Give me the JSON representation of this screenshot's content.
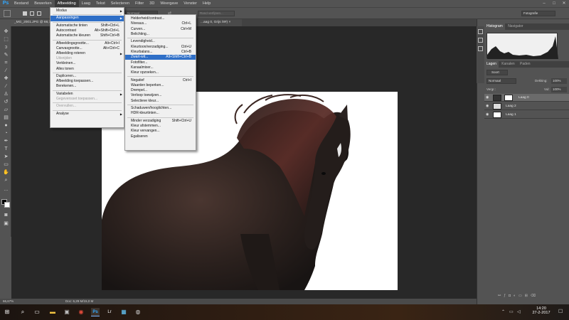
{
  "app": {
    "logo": "Ps"
  },
  "menubar": {
    "items": [
      "Bestand",
      "Bewerken",
      "Afbeelding",
      "Laag",
      "Tekst",
      "Selecteren",
      "Filter",
      "3D",
      "Weergave",
      "Venster",
      "Help"
    ],
    "active": "Afbeelding"
  },
  "window_controls": {
    "minimize": "–",
    "maximize": "□",
    "close": "✕"
  },
  "optionsbar": {
    "mode_value": "Normaal",
    "blend_field_value": "Rand verfijnen...",
    "workspace_value": "Fotografie"
  },
  "tabs": [
    {
      "label": "_MG_2001.JPG @ 66,7..."
    },
    {
      "label": "...aag 0, Grijs /8#) ×"
    }
  ],
  "menu_afbeelding": {
    "items": [
      {
        "label": "Modus",
        "shortcut": "",
        "submenu": true
      },
      {
        "sep": true
      },
      {
        "label": "Aanpassingen",
        "shortcut": "",
        "submenu": true,
        "highlight": true
      },
      {
        "sep": true
      },
      {
        "label": "Automatische tinten",
        "shortcut": "Shift+Ctrl+L"
      },
      {
        "label": "Autocontrast",
        "shortcut": "Alt+Shift+Ctrl+L"
      },
      {
        "label": "Automatische kleuren",
        "shortcut": "Shift+Ctrl+B"
      },
      {
        "sep": true
      },
      {
        "label": "Afbeeldingsgrootte...",
        "shortcut": "Alt+Ctrl+I"
      },
      {
        "label": "Canvasgrootte...",
        "shortcut": "Alt+Ctrl+C"
      },
      {
        "label": "Afbeelding roteren",
        "shortcut": "",
        "submenu": true
      },
      {
        "label": "Uitsnijden",
        "shortcut": "",
        "disabled": true
      },
      {
        "label": "Verkleinen...",
        "shortcut": ""
      },
      {
        "label": "Alles tonen",
        "shortcut": ""
      },
      {
        "sep": true
      },
      {
        "label": "Dupliceren...",
        "shortcut": ""
      },
      {
        "label": "Afbeelding toepassen...",
        "shortcut": ""
      },
      {
        "label": "Berekenen...",
        "shortcut": ""
      },
      {
        "sep": true
      },
      {
        "label": "Variabelen",
        "shortcut": "",
        "submenu": true
      },
      {
        "label": "Gegevensset toepassen...",
        "shortcut": "",
        "disabled": true
      },
      {
        "sep": true
      },
      {
        "label": "Overvullen...",
        "shortcut": "",
        "disabled": true
      },
      {
        "sep": true
      },
      {
        "label": "Analyse",
        "shortcut": "",
        "submenu": true
      }
    ]
  },
  "menu_aanpassingen": {
    "items": [
      {
        "label": "Helderheid/contrast...",
        "shortcut": ""
      },
      {
        "label": "Niveaus...",
        "shortcut": "Ctrl+L"
      },
      {
        "label": "Curven...",
        "shortcut": "Ctrl+M"
      },
      {
        "label": "Belichting...",
        "shortcut": ""
      },
      {
        "sep": true
      },
      {
        "label": "Levendigheid...",
        "shortcut": ""
      },
      {
        "label": "Kleurtoon/verzadiging...",
        "shortcut": "Ctrl+U"
      },
      {
        "label": "Kleurbalans...",
        "shortcut": "Ctrl+B"
      },
      {
        "label": "Zwart-wit...",
        "shortcut": "Alt+Shift+Ctrl+B",
        "highlight": true
      },
      {
        "label": "Fotofilter...",
        "shortcut": ""
      },
      {
        "label": "Kanaalmixer...",
        "shortcut": ""
      },
      {
        "label": "Kleur opzoeken...",
        "shortcut": ""
      },
      {
        "sep": true
      },
      {
        "label": "Negatief",
        "shortcut": "Ctrl+I"
      },
      {
        "label": "Waarden beperken...",
        "shortcut": ""
      },
      {
        "label": "Drempel...",
        "shortcut": ""
      },
      {
        "label": "Verloop toewijzen...",
        "shortcut": ""
      },
      {
        "label": "Selectieve kleur...",
        "shortcut": ""
      },
      {
        "sep": true
      },
      {
        "label": "Schaduwen/hooglichten...",
        "shortcut": ""
      },
      {
        "label": "HDR-kleurtinten...",
        "shortcut": ""
      },
      {
        "sep": true
      },
      {
        "label": "Minder verzadiging",
        "shortcut": "Shift+Ctrl+U"
      },
      {
        "label": "Kleur afstemmen...",
        "shortcut": ""
      },
      {
        "label": "Kleur vervangen...",
        "shortcut": ""
      },
      {
        "label": "Egaliseren",
        "shortcut": ""
      }
    ]
  },
  "panels": {
    "histogram_tabs": [
      "Histogram",
      "Navigator"
    ],
    "layers_tabs": [
      "Lagen",
      "Kanalen",
      "Paden"
    ],
    "layer_filter": "Soort",
    "blend_mode": "Normaal",
    "opacity_label": "Dekking:",
    "opacity_value": "100%",
    "fill_label": "Vul:",
    "fill_value": "100%",
    "lock_label": "Vergr.:",
    "layers": [
      {
        "name": "Laag 0",
        "selected": true
      },
      {
        "name": "Laag 2",
        "selected": false
      },
      {
        "name": "Laag 1",
        "selected": false
      }
    ]
  },
  "status": {
    "zoom": "66,67%",
    "doc": "Doc: 6,29 M/15,0 M"
  },
  "taskbar": {
    "time": "14:20",
    "date": "27-2-2017"
  },
  "colors": {
    "highlight": "#2f6fc7",
    "ps_blue": "#31a8ff"
  }
}
